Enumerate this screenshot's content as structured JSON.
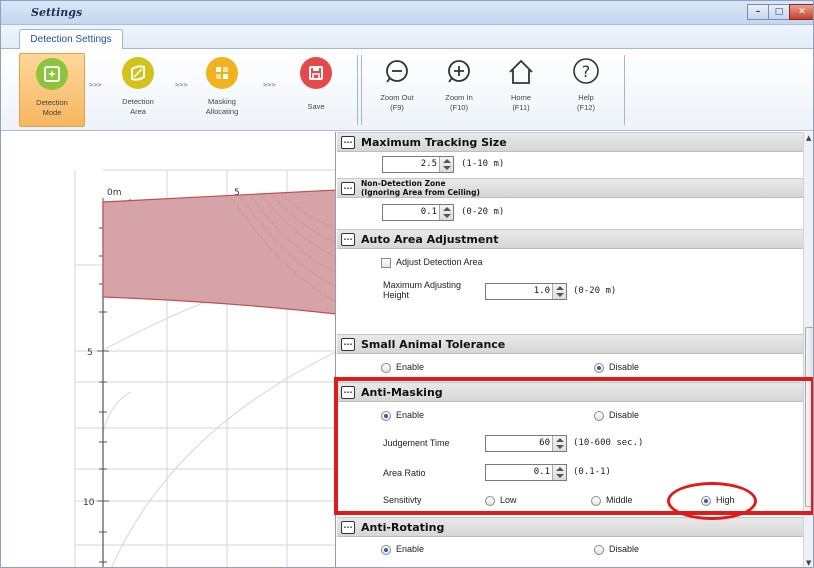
{
  "window": {
    "title": "Settings"
  },
  "tab": {
    "label": "Detection Settings"
  },
  "ribbon": {
    "steps": [
      {
        "label1": "Detection",
        "label2": "Mode",
        "icon": "detection-mode-icon",
        "color": "#8cc43c"
      },
      {
        "label1": "Detection",
        "label2": "Area",
        "icon": "detection-area-icon",
        "color": "#d4c21c"
      },
      {
        "label1": "Masking",
        "label2": "Allocating",
        "icon": "masking-icon",
        "color": "#f0b21e"
      },
      {
        "label1": "Save",
        "label2": "",
        "icon": "save-icon",
        "color": "#e54a4a"
      }
    ],
    "arrow_text": ">>>",
    "tools": [
      {
        "label1": "Zoom Out",
        "label2": "(F9)",
        "icon": "zoom-out-icon"
      },
      {
        "label1": "Zoom In",
        "label2": "(F10)",
        "icon": "zoom-in-icon"
      },
      {
        "label1": "Home",
        "label2": "(F11)",
        "icon": "home-icon"
      },
      {
        "label1": "Help",
        "label2": "(F12)",
        "icon": "help-icon"
      }
    ]
  },
  "canvas": {
    "ruler_top": [
      "0m",
      "5"
    ],
    "ruler_left": [
      "5",
      "10"
    ]
  },
  "sections": {
    "max_tracking": {
      "title": "Maximum Tracking Size",
      "value": "2.5",
      "range": "(1-10 m)"
    },
    "non_detection": {
      "title1": "Non-Detection Zone",
      "title2": "(Ignoring Area from Ceiling)",
      "value": "0.1",
      "range": "(0-20 m)"
    },
    "auto_area": {
      "title": "Auto Area Adjustment",
      "checkbox_label": "Adjust Detection Area",
      "height_label1": "Maximum Adjusting",
      "height_label2": "Height",
      "value": "1.0",
      "range": "(0-20 m)"
    },
    "small_animal": {
      "title": "Small Animal Tolerance",
      "enable": "Enable",
      "disable": "Disable",
      "selected": "Disable"
    },
    "anti_masking": {
      "title": "Anti-Masking",
      "enable": "Enable",
      "disable": "Disable",
      "selected": "Enable",
      "judgement_label": "Judgement Time",
      "judgement_value": "60",
      "judgement_range": "(10-600 sec.)",
      "ratio_label": "Area Ratio",
      "ratio_value": "0.1",
      "ratio_range": "(0.1-1)",
      "sensitivity_label": "Sensitivty",
      "low": "Low",
      "middle": "Middle",
      "high": "High",
      "sensitivity_selected": "High"
    },
    "anti_rotating": {
      "title": "Anti-Rotating",
      "enable": "Enable",
      "disable": "Disable",
      "selected": "Enable"
    }
  }
}
